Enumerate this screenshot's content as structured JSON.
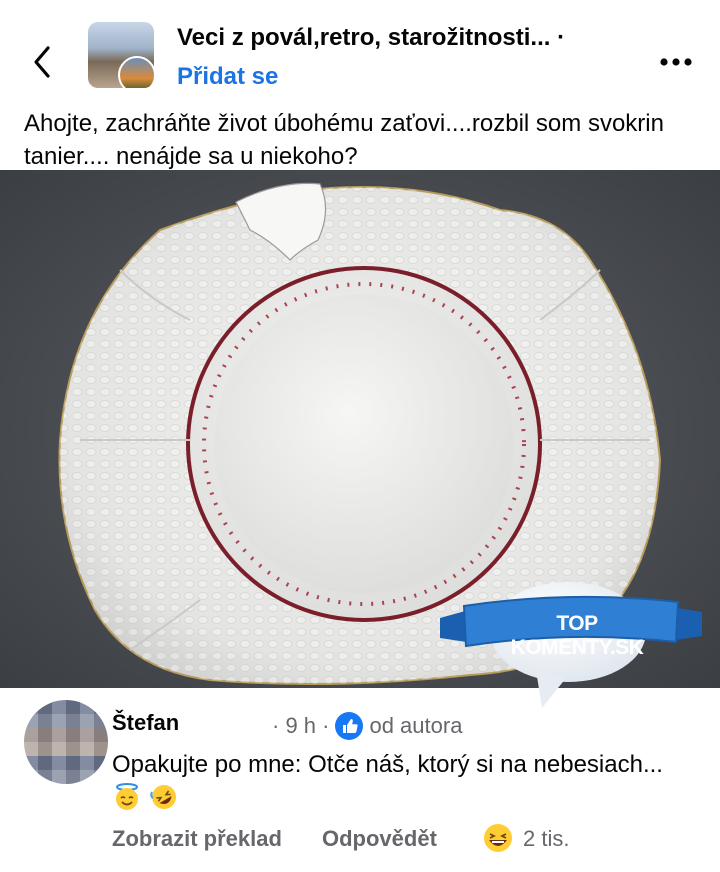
{
  "header": {
    "group_name": "Veci z povál,retro, starožitnosti... ·",
    "join_label": "Přidat se"
  },
  "post": {
    "text": "Ahojte, zachráňte život úbohému zaťovi....rozbil som svokrin tanier.... nenájde sa u niekoho?"
  },
  "watermark": {
    "label": "TOP KOMENTY.SK"
  },
  "comment": {
    "author": "Štefan",
    "time": "· 9 h ·",
    "author_badge": "od autora",
    "text": "Opakujte po mne:  Otče náš, ktorý  si na nebesiach...",
    "emojis": [
      "smiling-face-with-halo-icon",
      "rolling-on-floor-laughing-icon"
    ],
    "translate_label": "Zobrazit překlad",
    "reply_label": "Odpovědět",
    "reaction_count": "2 tis."
  },
  "colors": {
    "link": "#1b74e4",
    "secondary_text": "#65676b",
    "like_blue": "#1877f2"
  }
}
